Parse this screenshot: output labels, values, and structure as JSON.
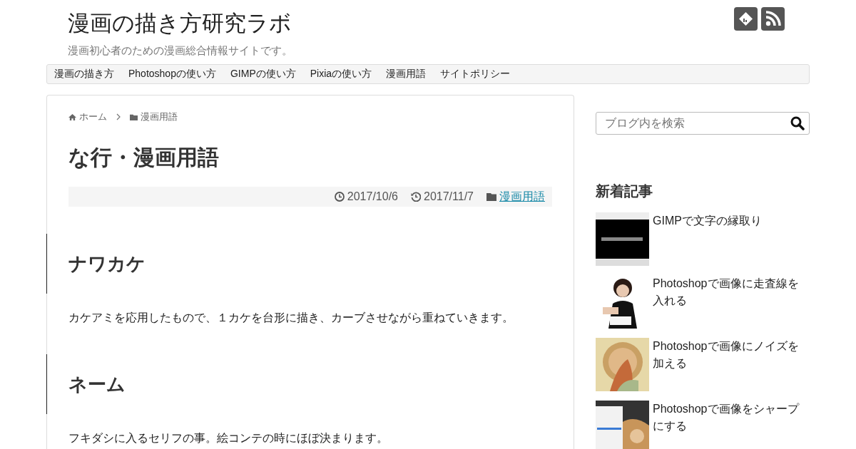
{
  "site": {
    "title": "漫画の描き方研究ラボ",
    "tagline": "漫画初心者のための漫画総合情報サイトです。"
  },
  "nav": [
    "漫画の描き方",
    "Photoshopの使い方",
    "GIMPの使い方",
    "Pixiaの使い方",
    "漫画用語",
    "サイトポリシー"
  ],
  "breadcrumb": [
    "ホーム",
    "漫画用語"
  ],
  "article": {
    "title": "な行・漫画用語",
    "posted": "2017/10/6",
    "updated": "2017/11/7",
    "category": "漫画用語",
    "sections": [
      {
        "heading": "ナワカケ",
        "text": "カケアミを応用したもので、１カケを台形に描き、カーブさせながら重ねていきます。"
      },
      {
        "heading": "ネーム",
        "text": "フキダシに入るセリフの事。絵コンテの時にほぼ決まります。"
      }
    ]
  },
  "sidebar": {
    "search": {
      "placeholder": "ブログ内を検索"
    },
    "recent_title": "新着記事",
    "recent": [
      {
        "title": "GIMPで文字の縁取り",
        "kind": "screen"
      },
      {
        "title": "Photoshopで画像に走査線を入れる",
        "kind": "figure"
      },
      {
        "title": "Photoshopで画像にノイズを加える",
        "kind": "art"
      },
      {
        "title": "Photoshopで画像をシャープにする",
        "kind": "app"
      }
    ]
  }
}
